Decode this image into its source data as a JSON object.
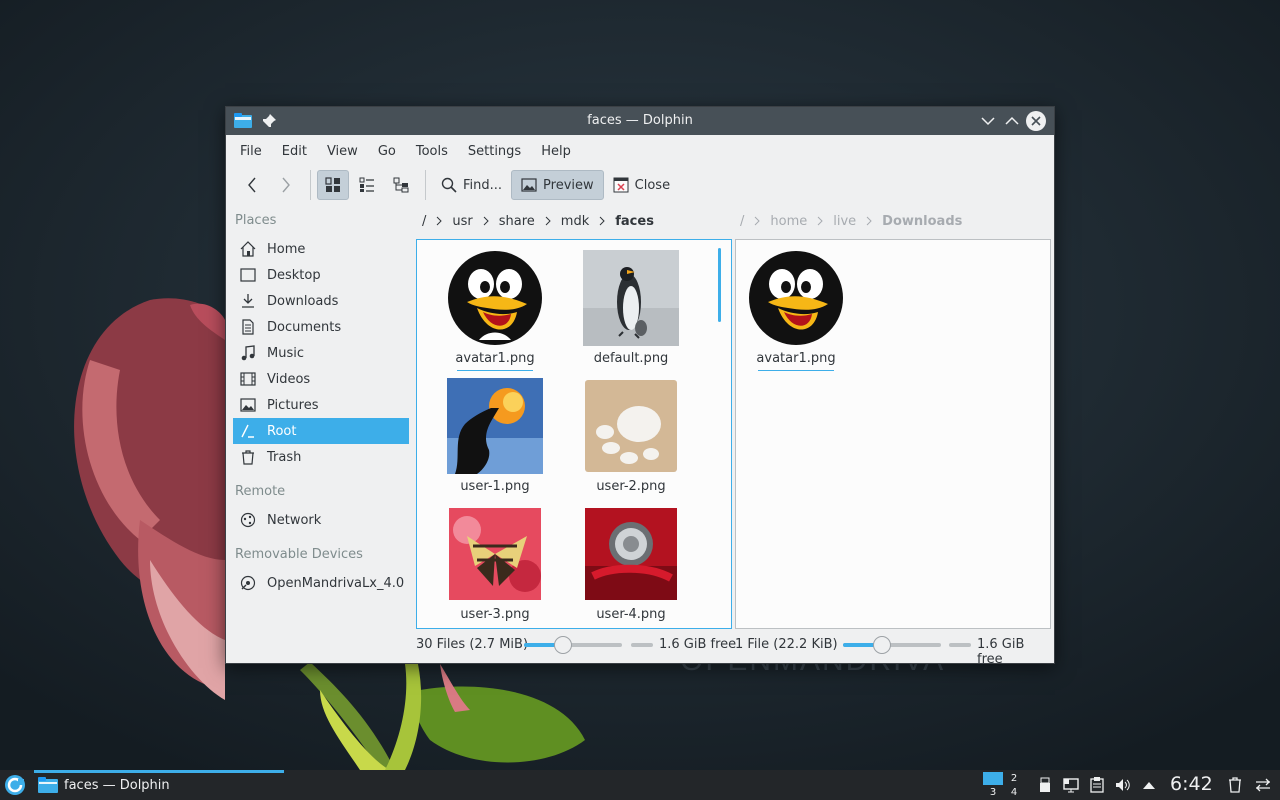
{
  "window": {
    "title": "faces — Dolphin",
    "icons": [
      "folder-icon",
      "pin-icon",
      "minimize-icon",
      "maximize-icon",
      "close-icon"
    ]
  },
  "menu": [
    "File",
    "Edit",
    "View",
    "Go",
    "Tools",
    "Settings",
    "Help"
  ],
  "toolbar": {
    "find_label": "Find...",
    "preview_label": "Preview",
    "close_label": "Close",
    "active_view": "icons",
    "preview_active": true
  },
  "places": {
    "header": "Places",
    "items": [
      {
        "label": "Home",
        "icon": "home-icon"
      },
      {
        "label": "Desktop",
        "icon": "desktop-icon"
      },
      {
        "label": "Downloads",
        "icon": "downloads-icon"
      },
      {
        "label": "Documents",
        "icon": "documents-icon"
      },
      {
        "label": "Music",
        "icon": "music-icon"
      },
      {
        "label": "Videos",
        "icon": "videos-icon"
      },
      {
        "label": "Pictures",
        "icon": "pictures-icon"
      },
      {
        "label": "Root",
        "icon": "root-icon",
        "selected": true
      },
      {
        "label": "Trash",
        "icon": "trash-icon"
      }
    ],
    "remote_header": "Remote",
    "remote_items": [
      {
        "label": "Network",
        "icon": "network-icon"
      }
    ],
    "devices_header": "Removable Devices",
    "device_items": [
      {
        "label": "OpenMandrivaLx_4.0",
        "icon": "drive-icon"
      }
    ]
  },
  "left_pane": {
    "breadcrumb": [
      "/",
      "usr",
      "share",
      "mdk",
      "faces"
    ],
    "files": [
      {
        "name": "avatar1.png",
        "thumb": "tux-avatar"
      },
      {
        "name": "default.png",
        "thumb": "penguin-photo"
      },
      {
        "name": "user-1.png",
        "thumb": "fire-photo"
      },
      {
        "name": "user-2.png",
        "thumb": "pebbles-photo"
      },
      {
        "name": "user-3.png",
        "thumb": "butterfly-photo"
      },
      {
        "name": "user-4.png",
        "thumb": "scooter-photo"
      }
    ],
    "status": "30 Files (2.7 MiB)",
    "free_space": "1.6 GiB free"
  },
  "right_pane": {
    "breadcrumb": [
      "/",
      "home",
      "live",
      "Downloads"
    ],
    "files": [
      {
        "name": "avatar1.png",
        "thumb": "tux-avatar"
      }
    ],
    "status": "1 File (22.2 KiB)",
    "free_space": "1.6 GiB free"
  },
  "taskbar": {
    "task_label": "faces — Dolphin",
    "pager": [
      "1",
      "2",
      "3",
      "4"
    ],
    "active_desktop": "1",
    "clock": "6:42",
    "tray_icons": [
      "usb-icon",
      "network-tray-icon",
      "clipboard-icon",
      "volume-icon",
      "expand-tray-icon",
      "trash-tray-icon",
      "panel-settings-icon"
    ]
  },
  "colors": {
    "accent": "#3daee9",
    "titlebar": "#475057",
    "window_bg": "#eff0f1",
    "taskbar": "#232629"
  }
}
